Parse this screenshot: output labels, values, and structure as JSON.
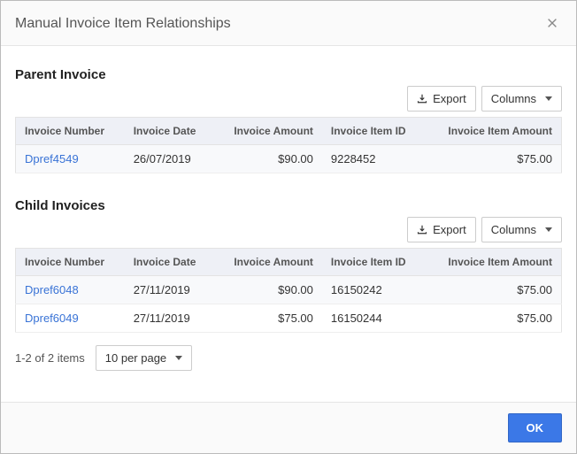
{
  "header": {
    "title": "Manual Invoice Item Relationships"
  },
  "parent": {
    "title": "Parent Invoice",
    "export_label": "Export",
    "columns_label": "Columns",
    "cols": {
      "number": "Invoice Number",
      "date": "Invoice Date",
      "amount": "Invoice Amount",
      "item_id": "Invoice Item ID",
      "item_amount": "Invoice Item Amount"
    },
    "rows": [
      {
        "number": "Dpref4549",
        "date": "26/07/2019",
        "amount": "$90.00",
        "item_id": "9228452",
        "item_amount": "$75.00"
      }
    ]
  },
  "child": {
    "title": "Child Invoices",
    "export_label": "Export",
    "columns_label": "Columns",
    "cols": {
      "number": "Invoice Number",
      "date": "Invoice Date",
      "amount": "Invoice Amount",
      "item_id": "Invoice Item ID",
      "item_amount": "Invoice Item Amount"
    },
    "rows": [
      {
        "number": "Dpref6048",
        "date": "27/11/2019",
        "amount": "$90.00",
        "item_id": "16150242",
        "item_amount": "$75.00"
      },
      {
        "number": "Dpref6049",
        "date": "27/11/2019",
        "amount": "$75.00",
        "item_id": "16150244",
        "item_amount": "$75.00"
      }
    ]
  },
  "pager": {
    "summary": "1-2 of 2 items",
    "per_page_label": "10 per page"
  },
  "footer": {
    "ok_label": "OK"
  }
}
